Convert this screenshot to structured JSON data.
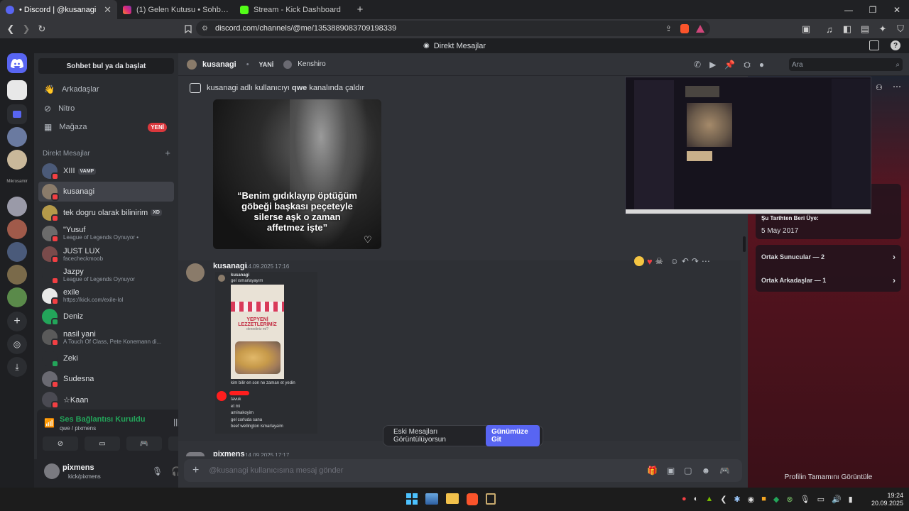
{
  "browser": {
    "tabs": [
      {
        "title": "• Discord | @kusanagi",
        "color": "#5865f2",
        "active": true
      },
      {
        "title": "(1) Gelen Kutusu • Sohbetler",
        "color": "#e1306c",
        "active": false
      },
      {
        "title": "Stream - Kick Dashboard",
        "color": "#53fc18",
        "active": false
      }
    ],
    "new_tab": "+",
    "url": "discord.com/channels/@me/1353889083709198339"
  },
  "app_title": "Direkt Mesajlar",
  "sidebar": {
    "search": "Sohbet bul ya da başlat",
    "nav": [
      {
        "label": "Arkadaşlar",
        "icon": "friends-icon"
      },
      {
        "label": "Nitro",
        "icon": "nitro-icon"
      },
      {
        "label": "Mağaza",
        "icon": "shop-icon",
        "badge": "YENİ"
      }
    ],
    "dm_header": "Direkt Mesajlar",
    "dm_add": "+",
    "rail_label": "Mikrosamir",
    "dms": [
      {
        "name": "XIII",
        "tag": "VAMP",
        "sub": "",
        "color": "#4b5a78",
        "status": "dnd"
      },
      {
        "name": "kusanagi",
        "tag": "",
        "sub": "",
        "color": "#8a7b6a",
        "status": "dnd",
        "active": true
      },
      {
        "name": "tek dogru olarak bilinirim",
        "tag": "XD",
        "sub": "",
        "color": "#b59a4a",
        "status": "dnd"
      },
      {
        "name": "\"Yusuf",
        "tag": "",
        "sub": "League of Legends Oynuyor •",
        "color": "#6b6b6b",
        "status": "dnd"
      },
      {
        "name": "JUST LUX",
        "tag": "",
        "sub": "facecheckmoob",
        "color": "#7a4b4b",
        "status": "dnd"
      },
      {
        "name": "Jazpy",
        "tag": "",
        "sub": "League of Legends Oynuyor",
        "color": "#2b2d31",
        "status": "dnd"
      },
      {
        "name": "exile",
        "tag": "",
        "sub": "https://kick.com/exile-lol",
        "color": "#e8e8e8",
        "status": "dnd"
      },
      {
        "name": "Deniz",
        "tag": "",
        "sub": "",
        "color": "#23a55a",
        "status": "online"
      },
      {
        "name": "nasil yani",
        "tag": "",
        "sub": "A Touch Of Class, Pete Konemann di...",
        "color": "#5a5a5a",
        "status": "dnd"
      },
      {
        "name": "Zeki",
        "tag": "",
        "sub": "",
        "color": "#2b2d31",
        "status": "online"
      },
      {
        "name": "Sudesna",
        "tag": "",
        "sub": "",
        "color": "#6a6a72",
        "status": "dnd"
      },
      {
        "name": "☆Kaan",
        "tag": "",
        "sub": "",
        "color": "#4a4a52",
        "status": "dnd"
      }
    ],
    "voice": {
      "status": "Ses Bağlantısı Kuruldu",
      "channel": "qwe / pixmens"
    },
    "user": {
      "name": "pixmens",
      "sub": "kick/pixmens"
    }
  },
  "chat": {
    "header": {
      "user": "kusanagi",
      "separator": "YANİ",
      "other": "Kenshiro",
      "search_placeholder": "Ara"
    },
    "notice": "kusanagi adlı kullanıcıyı qwe kanalında çaldır",
    "notice_bold": "qwe",
    "image_caption": [
      "“Benim gıdıklayıp öptüğüm",
      "göbeği başkası peçeteyle",
      "silerse aşk o zaman",
      "affetmez işte”"
    ],
    "message": {
      "author": "kusanagi",
      "time": "14.09.2025 17:16",
      "embed_author": "kusanagi",
      "embed_line1": "gel ısmarlayayım",
      "poster_line1": "YEPYENİ",
      "poster_line2": "LEZZETLERİMİZ",
      "poster_line3": "denediniz mi?",
      "embed_line2": "kim bilir en son ne zaman et yedin",
      "embed_lines": [
        "tavuk",
        "et mi",
        "aminakoyim",
        "gel corluda sana",
        "beef wellington ismarlayaim"
      ]
    },
    "next_author": "pixmens",
    "next_time": "14.09.2025 17:17",
    "old_banner": "Eski Mesajları Görüntülüyorsun",
    "jump": "Günümüze Git",
    "composer_placeholder": "@kusanagi kullanıcısına mesaj gönder"
  },
  "profile": {
    "member_since_label": "Şu Tarihten Beri Üye:",
    "member_since": "5 May 2017",
    "mutual_servers": "Ortak Sunucular — 2",
    "mutual_friends": "Ortak Arkadaşlar — 1",
    "view_full": "Profilin Tamamını Görüntüle"
  },
  "taskbar": {
    "time": "19:24",
    "date": "20.09.2025"
  }
}
